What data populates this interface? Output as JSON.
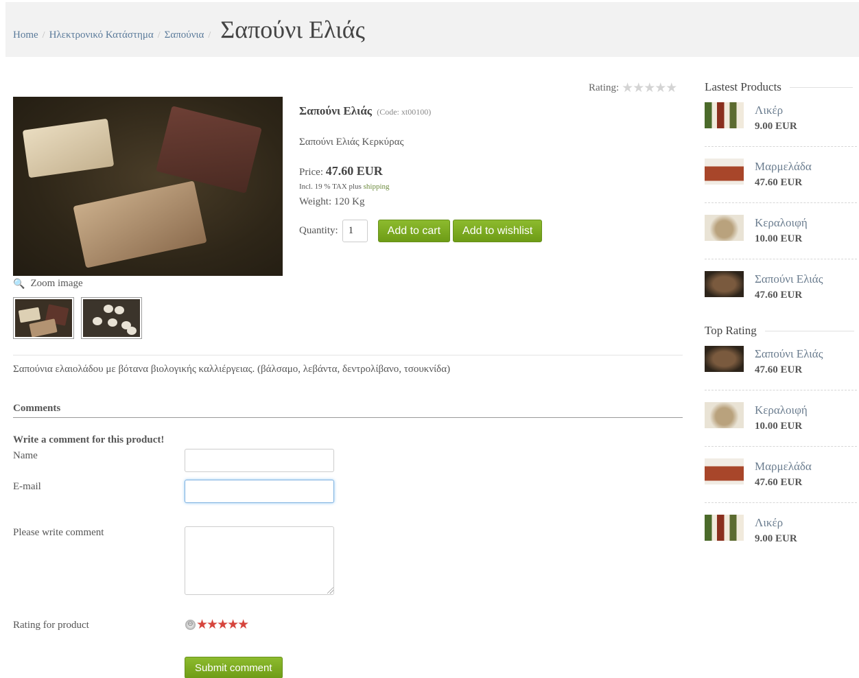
{
  "breadcrumb": {
    "items": [
      "Home",
      "Ηλεκτρονικό Κατάστημα",
      "Σαπούνια"
    ],
    "separator": "/",
    "current": "Σαπούνι Ελιάς"
  },
  "product": {
    "name": "Σαπούνι Ελιάς",
    "code": "(Code: xt00100)",
    "subtitle": "Σαπούνι Ελιάς Κερκύρας",
    "rating_label": "Rating:",
    "rating_stars": "★★★★★",
    "rating_value": 0,
    "rating_max": 5,
    "zoom_label": "Zoom image",
    "price_label": "Price:",
    "price_value": "47.60 EUR",
    "tax_prefix": "Incl. 19 % TAX plus ",
    "tax_link": "shipping",
    "weight": "Weight: 120 Kg",
    "quantity_label": "Quantity:",
    "quantity_value": "1",
    "add_to_cart": "Add to cart",
    "add_to_wishlist": "Add to wishlist",
    "description": "Σαπούνια ελαιολάδου με βότανα βιολογικής καλλιέργειας. (βάλσαμο, λεβάντα, δεντρολίβανο, τσουκνίδα)"
  },
  "comments": {
    "title": "Comments",
    "write_prompt": "Write a comment for this product!",
    "name_label": "Name",
    "name_value": "",
    "email_label": "E-mail",
    "email_value": "",
    "comment_label": "Please write comment",
    "comment_value": "",
    "rating_label": "Rating for product",
    "rating_stars": "★★★★★",
    "cancel_glyph": "⊖",
    "submit": "Submit comment"
  },
  "sidebar": {
    "latest_title": "Lastest Products",
    "latest": [
      {
        "name": "Λικέρ",
        "price": "9.00 EUR"
      },
      {
        "name": "Μαρμελάδα",
        "price": "47.60 EUR"
      },
      {
        "name": "Κεραλοιφή",
        "price": "10.00 EUR"
      },
      {
        "name": "Σαπούνι Ελιάς",
        "price": "47.60 EUR"
      }
    ],
    "top_title": "Top Rating",
    "top": [
      {
        "name": "Σαπούνι Ελιάς",
        "price": "47.60 EUR"
      },
      {
        "name": "Κεραλοιφή",
        "price": "10.00 EUR"
      },
      {
        "name": "Μαρμελάδα",
        "price": "47.60 EUR"
      },
      {
        "name": "Λικέρ",
        "price": "9.00 EUR"
      }
    ]
  },
  "colors": {
    "button_green": "#7aaa1e",
    "rating_red": "#d6453d",
    "link_blue": "#5a7a9a"
  },
  "icons": {
    "zoom": "magnifier-icon",
    "rating_cancel": "cancel-rating-icon",
    "star": "star-icon"
  }
}
